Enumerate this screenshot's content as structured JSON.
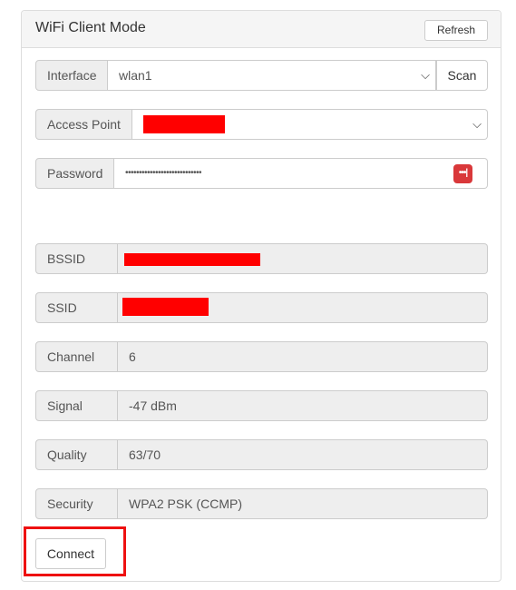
{
  "panel": {
    "title": "WiFi Client Mode",
    "refresh_label": "Refresh"
  },
  "form": {
    "interface": {
      "label": "Interface",
      "value": "wlan1",
      "scan_label": "Scan"
    },
    "access_point": {
      "label": "Access Point",
      "value_redacted": true
    },
    "password": {
      "label": "Password",
      "value": "••••••••••••••••••••••••••••",
      "reveal_icon_text": "•••|"
    }
  },
  "status": {
    "bssid": {
      "label": "BSSID",
      "value_redacted": true
    },
    "ssid": {
      "label": "SSID",
      "value_redacted": true
    },
    "channel": {
      "label": "Channel",
      "value": "6"
    },
    "signal": {
      "label": "Signal",
      "value": "-47 dBm"
    },
    "quality": {
      "label": "Quality",
      "value": "63/70"
    },
    "security": {
      "label": "Security",
      "value": "WPA2 PSK (CCMP)"
    }
  },
  "actions": {
    "connect_label": "Connect"
  },
  "colors": {
    "redaction": "#ff0000",
    "highlight_border": "#ee1111",
    "password_icon": "#d9383a"
  }
}
